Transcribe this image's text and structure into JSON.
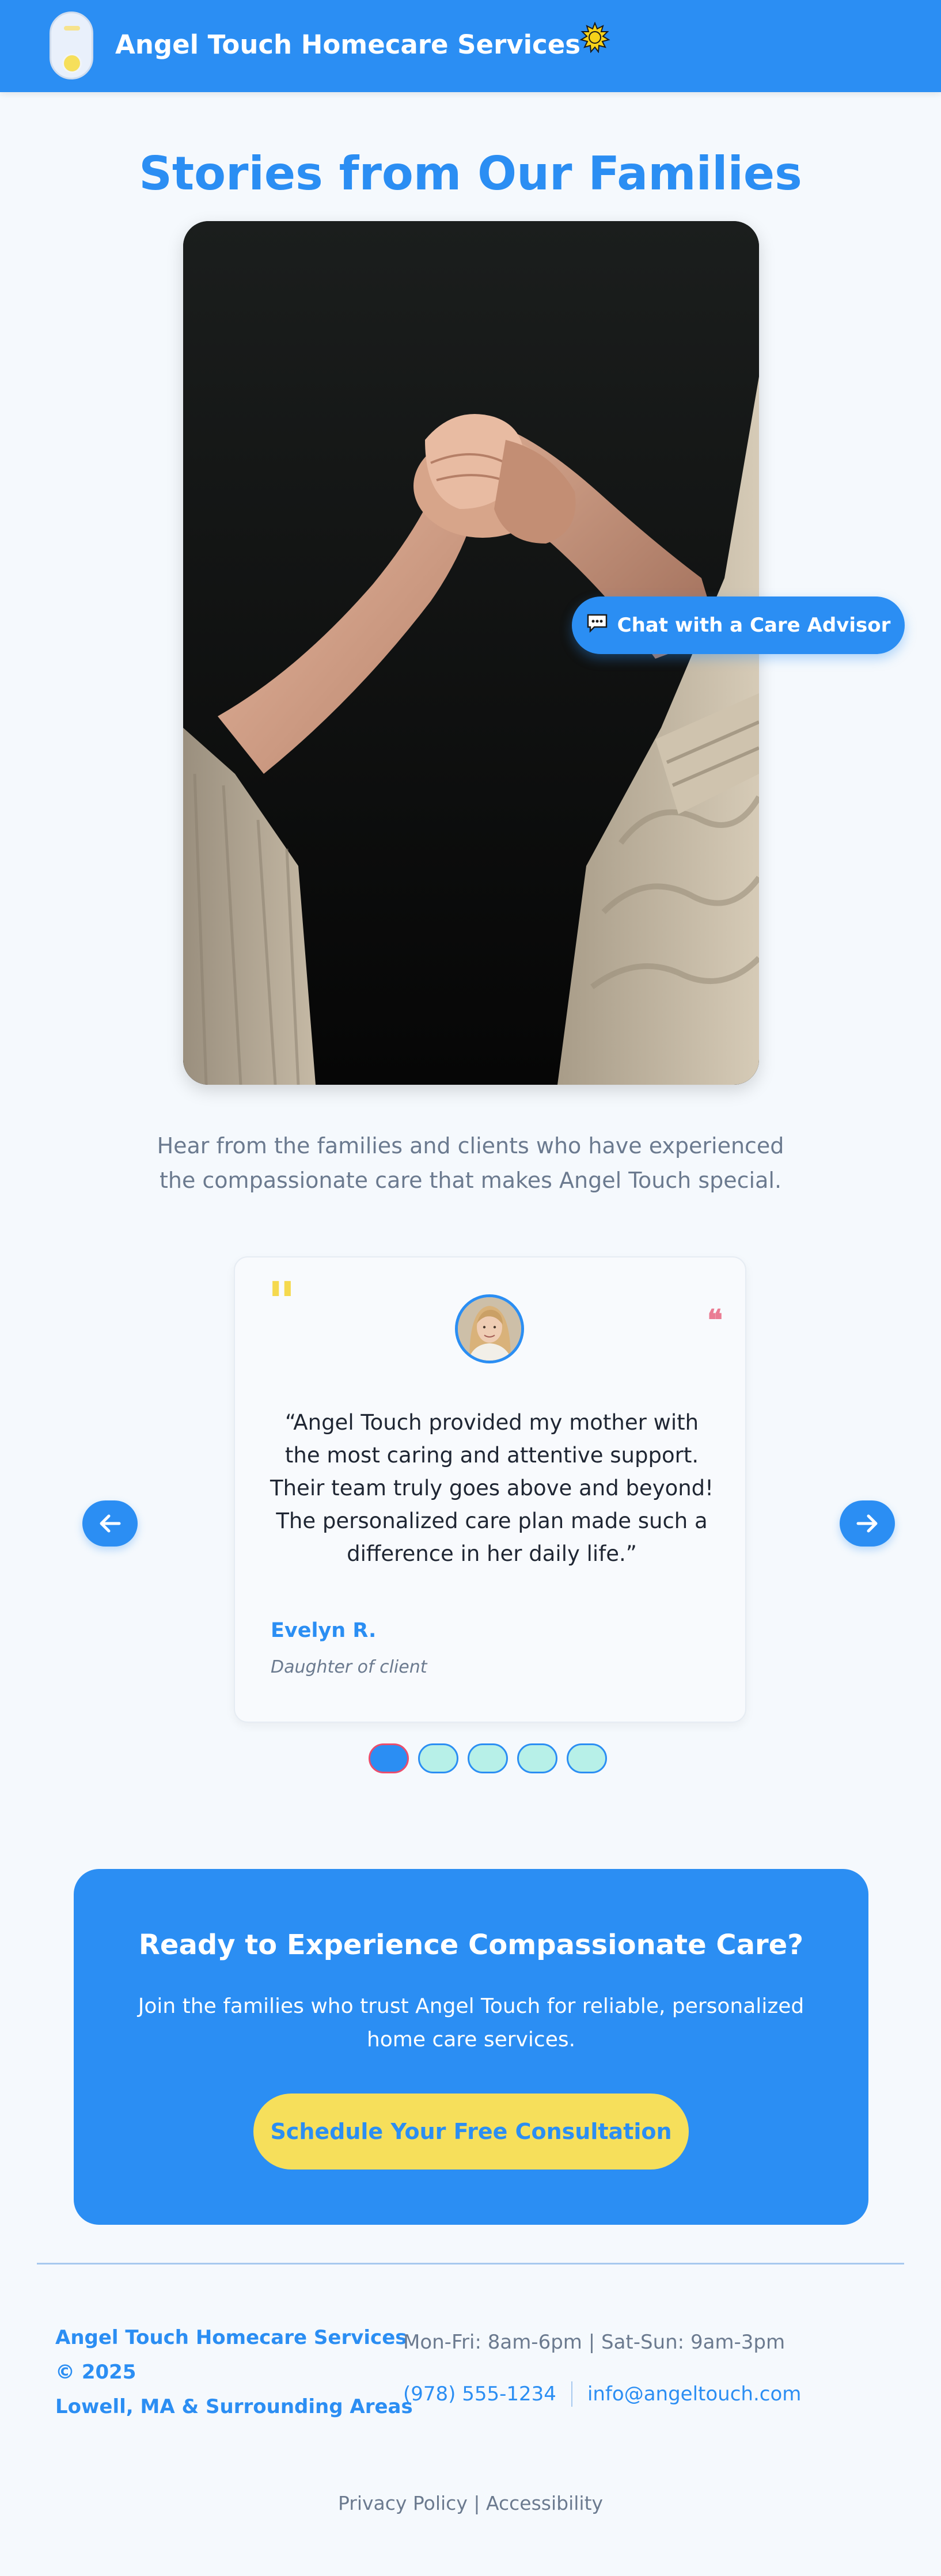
{
  "header": {
    "brand": "Angel Touch Homecare Services",
    "theme_icon": "sun-icon"
  },
  "hero": {
    "title": "Stories from Our Families",
    "image_alt": "Hands holding an elderly person's hands"
  },
  "chat": {
    "label": "Chat with a Care Advisor",
    "icon": "chat-bubble-icon"
  },
  "intro": "Hear from the families and clients who have experienced the compassionate care that makes Angel Touch special.",
  "testimonial": {
    "quote": "“Angel Touch provided my mother with the most caring and attentive support. Their team truly goes above and beyond! The personalized care plan made such a difference in her daily life.”",
    "author": "Evelyn R.",
    "role": "Daughter of client",
    "open_mark": "\"",
    "close_mark": "❝"
  },
  "carousel": {
    "count": 5,
    "active": 1,
    "prev_icon": "arrow-left-icon",
    "next_icon": "arrow-right-icon"
  },
  "cta": {
    "title": "Ready to Experience Compassionate Care?",
    "text": "Join the families who trust Angel Touch for reliable, personalized home care services.",
    "button": "Schedule Your Free Consultation"
  },
  "footer": {
    "brand_line1": "Angel Touch Homecare Services",
    "brand_line2": "© 2025",
    "brand_line3": "Lowell, MA & Surrounding Areas",
    "hours": "Mon-Fri: 8am-6pm | Sat-Sun: 9am-3pm",
    "phone": "(978) 555-1234",
    "email": "info@angeltouch.com",
    "privacy": "Privacy Policy",
    "link_sep": "|",
    "accessibility": "Accessibility"
  },
  "colors": {
    "primary": "#2b8ef3",
    "accent_yellow": "#f6df5b",
    "accent_pink": "#ea7c93",
    "background": "#f5f9fd"
  }
}
